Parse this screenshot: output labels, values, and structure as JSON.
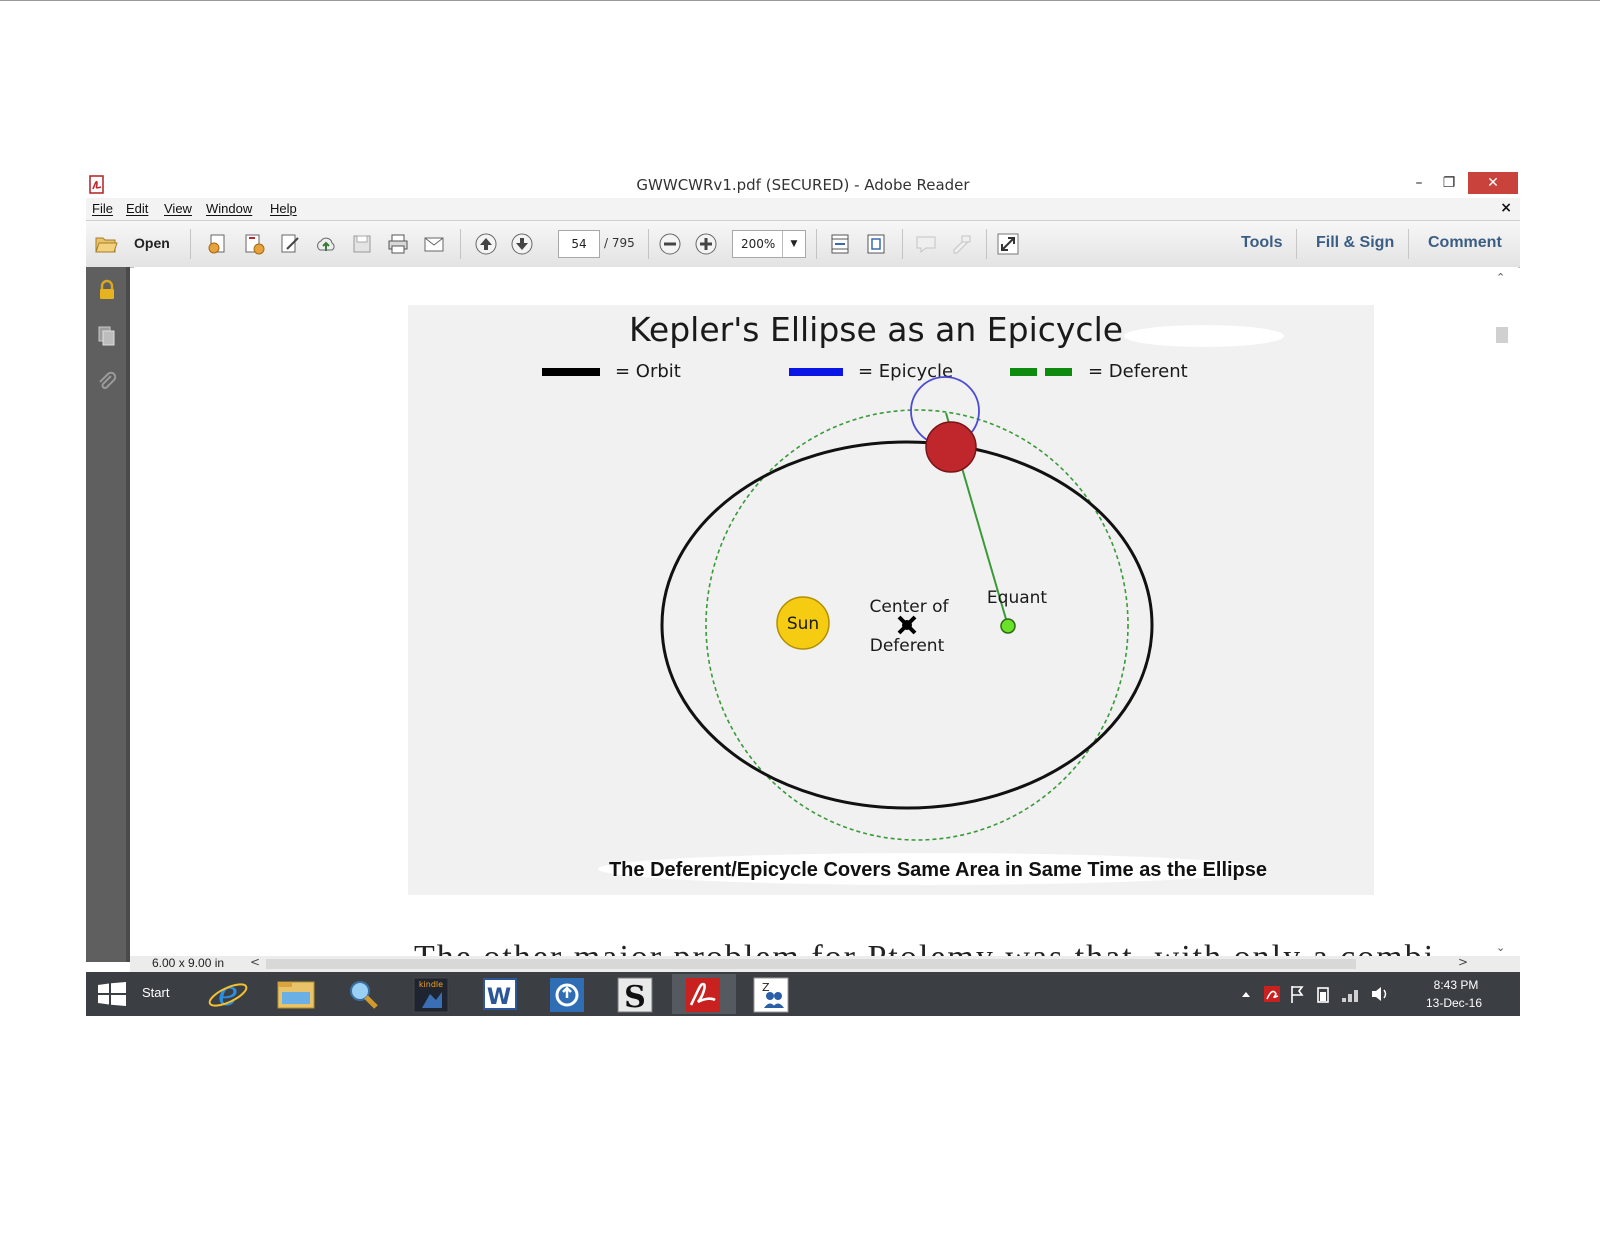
{
  "window": {
    "title": "GWWCWRv1.pdf (SECURED) - Adobe Reader",
    "controls": {
      "minimize": "–",
      "restore": "❐",
      "close": "✕"
    }
  },
  "menu": {
    "items": [
      "File",
      "Edit",
      "View",
      "Window",
      "Help"
    ],
    "close": "×"
  },
  "toolbar": {
    "open_label": "Open",
    "page_current": "54",
    "page_total": "/ 795",
    "zoom": "200%",
    "links": [
      "Tools",
      "Fill & Sign",
      "Comment"
    ]
  },
  "figure": {
    "title": "Kepler's Ellipse as an Epicycle",
    "legend": [
      {
        "label": "= Orbit",
        "color": "#000000"
      },
      {
        "label": "= Epicycle",
        "color": "#0a16e6"
      },
      {
        "label": "= Deferent",
        "color": "#0e8a0e"
      }
    ],
    "labels": {
      "sun": "Sun",
      "center_line1": "Center of",
      "center_line2": "Deferent",
      "equant": "Equant"
    },
    "caption": "The Deferent/Epicycle Covers Same Area in Same Time as the Ellipse",
    "colors": {
      "sun": "#f5cc11",
      "planet": "#c0272c",
      "equant": "#6be22a",
      "epicycle": "#4b4bd6",
      "deferent": "#3a9a3a",
      "orbit": "#111111"
    }
  },
  "document": {
    "partial_line": "The other major problem for Ptolemy was that, with only a combi"
  },
  "status": {
    "page_size": "6.00 x 9.00 in"
  },
  "taskbar": {
    "start": "Start",
    "time": "8:43 PM",
    "date": "13-Dec-16"
  }
}
